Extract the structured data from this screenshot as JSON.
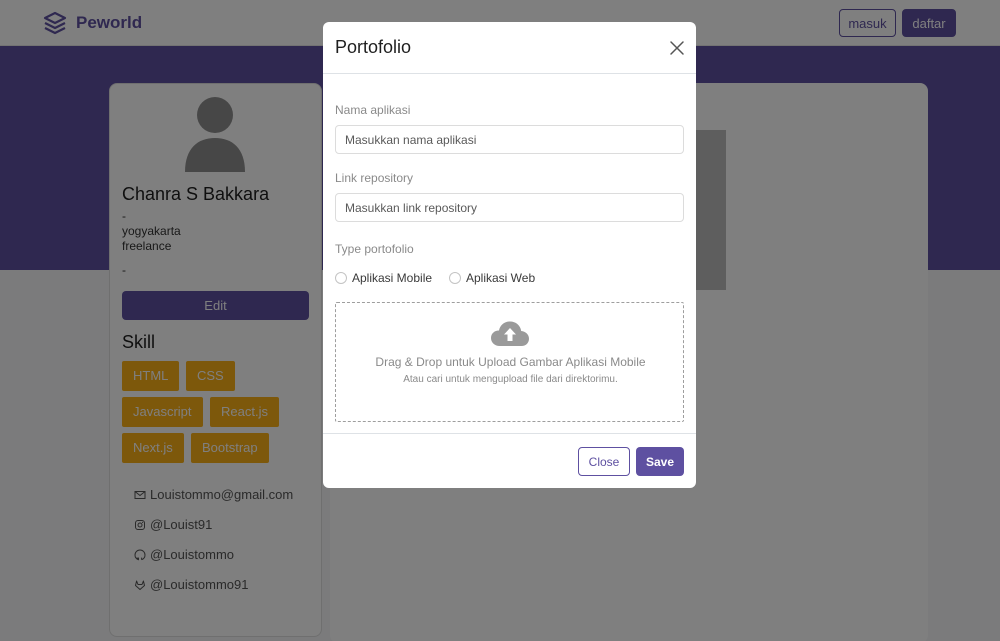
{
  "navbar": {
    "brand": "Peworld",
    "login_label": "masuk",
    "register_label": "daftar"
  },
  "profile": {
    "name": "Chanra S Bakkara",
    "line1": "-",
    "location": "yogyakarta",
    "job": "freelance",
    "line4": "-",
    "edit_label": "Edit",
    "skill_title": "Skill",
    "skills": [
      "HTML",
      "CSS",
      "Javascript",
      "React.js",
      "Next.js",
      "Bootstrap"
    ],
    "contacts": [
      {
        "icon": "mail-icon",
        "text": "Louistommo@gmail.com"
      },
      {
        "icon": "instagram-icon",
        "text": "@Louist91"
      },
      {
        "icon": "github-icon",
        "text": "@Louistommo"
      },
      {
        "icon": "gitlab-icon",
        "text": "@Louistommo91"
      }
    ]
  },
  "modal": {
    "title": "Portofolio",
    "app_name_label": "Nama aplikasi",
    "app_name_placeholder": "Masukkan nama aplikasi",
    "app_name_value": "",
    "repo_label": "Link repository",
    "repo_placeholder": "Masukkan link repository",
    "repo_value": "",
    "type_label": "Type portofolio",
    "type_options": [
      "Aplikasi Mobile",
      "Aplikasi Web"
    ],
    "dropzone_text": "Drag & Drop untuk Upload Gambar Aplikasi Mobile",
    "dropzone_subtext": "Atau cari untuk mengupload file dari direktorimu.",
    "close_label": "Close",
    "save_label": "Save"
  },
  "colors": {
    "primary": "#5e50a1",
    "skill_badge": "#fbb017",
    "overlay": "rgba(0,0,0,0.5)"
  }
}
